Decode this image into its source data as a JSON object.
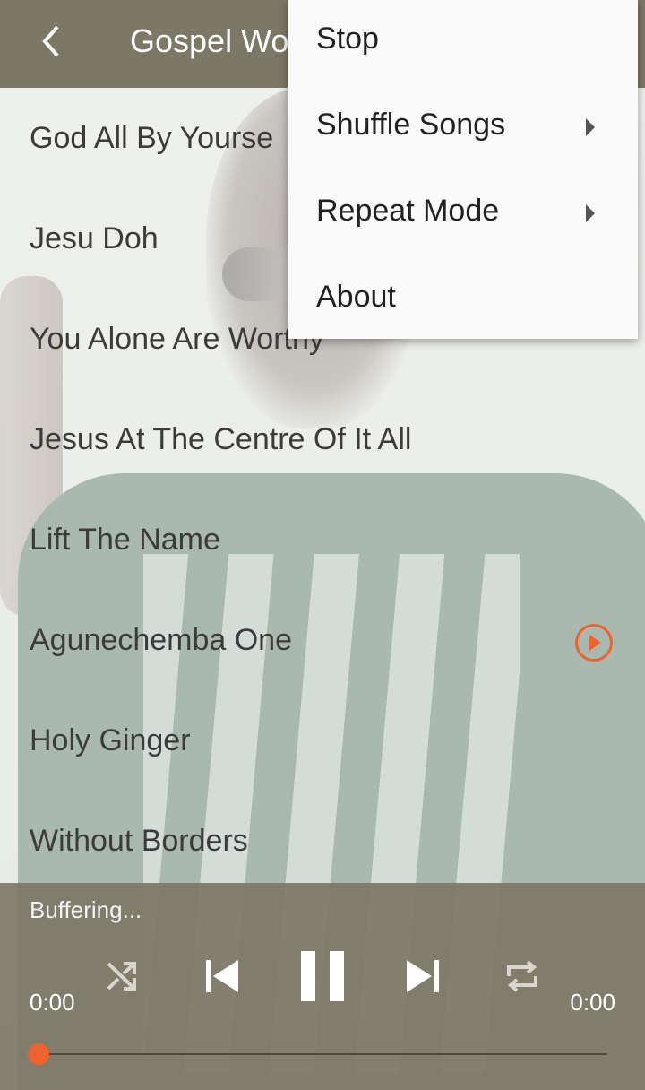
{
  "appbar": {
    "title": "Gospel Wo",
    "back_icon": "back-arrow-icon"
  },
  "songs": [
    {
      "title": "God All By Yourse",
      "playing": false
    },
    {
      "title": "Jesu Doh",
      "playing": false
    },
    {
      "title": "You Alone Are Worthy",
      "playing": false
    },
    {
      "title": "Jesus At The Centre Of It All",
      "playing": false
    },
    {
      "title": "Lift The Name",
      "playing": false
    },
    {
      "title": "Agunechemba One",
      "playing": true
    },
    {
      "title": "Holy Ginger",
      "playing": false
    },
    {
      "title": "Without Borders",
      "playing": false
    }
  ],
  "menu": {
    "items": [
      {
        "label": "Stop",
        "submenu": false
      },
      {
        "label": "Shuffle Songs",
        "submenu": true
      },
      {
        "label": "Repeat Mode",
        "submenu": true
      },
      {
        "label": "About",
        "submenu": false
      }
    ]
  },
  "player": {
    "status": "Buffering...",
    "elapsed": "0:00",
    "duration": "0:00",
    "progress": 0,
    "icons": [
      "shuffle-icon",
      "previous-icon",
      "pause-icon",
      "next-icon",
      "repeat-icon"
    ]
  },
  "colors": {
    "appbar": "#7d7766",
    "accent": "#f0622c",
    "menu_bg": "#fafafa"
  }
}
